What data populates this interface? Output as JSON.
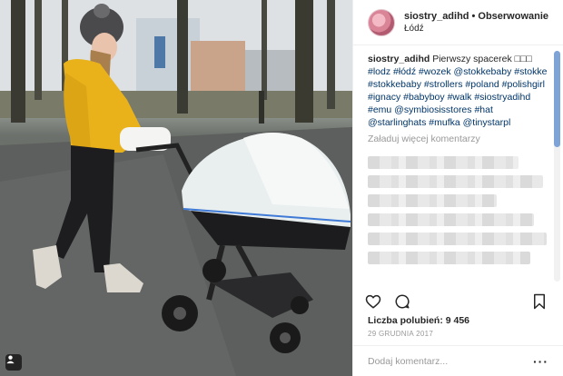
{
  "post": {
    "username": "siostry_adihd",
    "separator": "•",
    "follow_label": "Obserwowanie",
    "location": "Łódź",
    "caption_user": "siostry_adihd",
    "caption_text": " Pierwszy spacerek □□□ ",
    "caption_tags": "#lodz #łódź #wozek @stokkebaby #stokke #stokkebaby #strollers #poland #polishgirl #ignacy #babyboy #walk #siostryadihd #emu @symbiosisstores #hat @starlinghats #mufka @tinystarpl",
    "load_more": "Załaduj więcej komentarzy",
    "likes_text": "Liczba polubień: 9 456",
    "date": "29 grudnia 2017",
    "comment_placeholder": "Dodaj komentarz...",
    "more_label": "···"
  },
  "icons": {
    "like": "heart-icon",
    "comment": "comment-icon",
    "save": "bookmark-icon",
    "photo_badge": "user-tag-icon"
  },
  "colors": {
    "text": "#262626",
    "secondary": "#999999",
    "hashtag": "#003569",
    "border": "#efefef",
    "scroll_thumb": "#7ea3d6"
  }
}
